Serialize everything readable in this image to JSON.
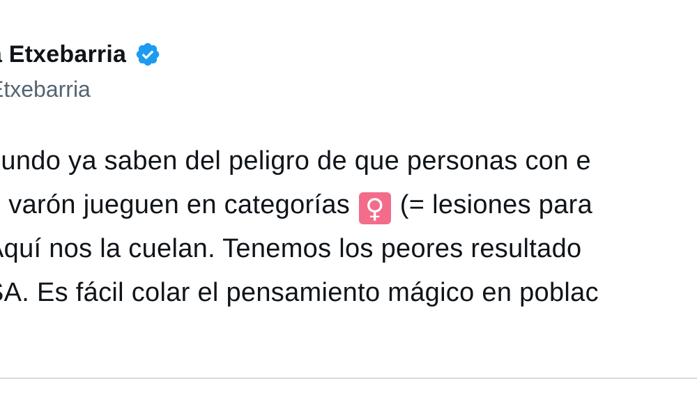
{
  "tweet": {
    "author": {
      "display_name_fragment": "a Etxebarria",
      "handle_fragment": "Etxebarria",
      "verified": true,
      "verified_color": "#1d9bf0",
      "verified_icon": "verified-badge-icon"
    },
    "text": {
      "line1": "nundo ya saben del peligro de  que personas con e",
      "line2_before": "e varón jueguen en categorías ",
      "female_emoji": "♀",
      "line2_after": " (= lesiones para",
      "line3": " Aquí nos la cuelan. Tenemos los peores resultado",
      "line4": "SA. Es fácil colar el pensamiento mágico en poblac",
      "line5": "."
    },
    "colors": {
      "text": "#0f1419",
      "secondary": "#536471",
      "emoji_bg": "#f36c8a",
      "divider": "#d6dbe0"
    }
  }
}
